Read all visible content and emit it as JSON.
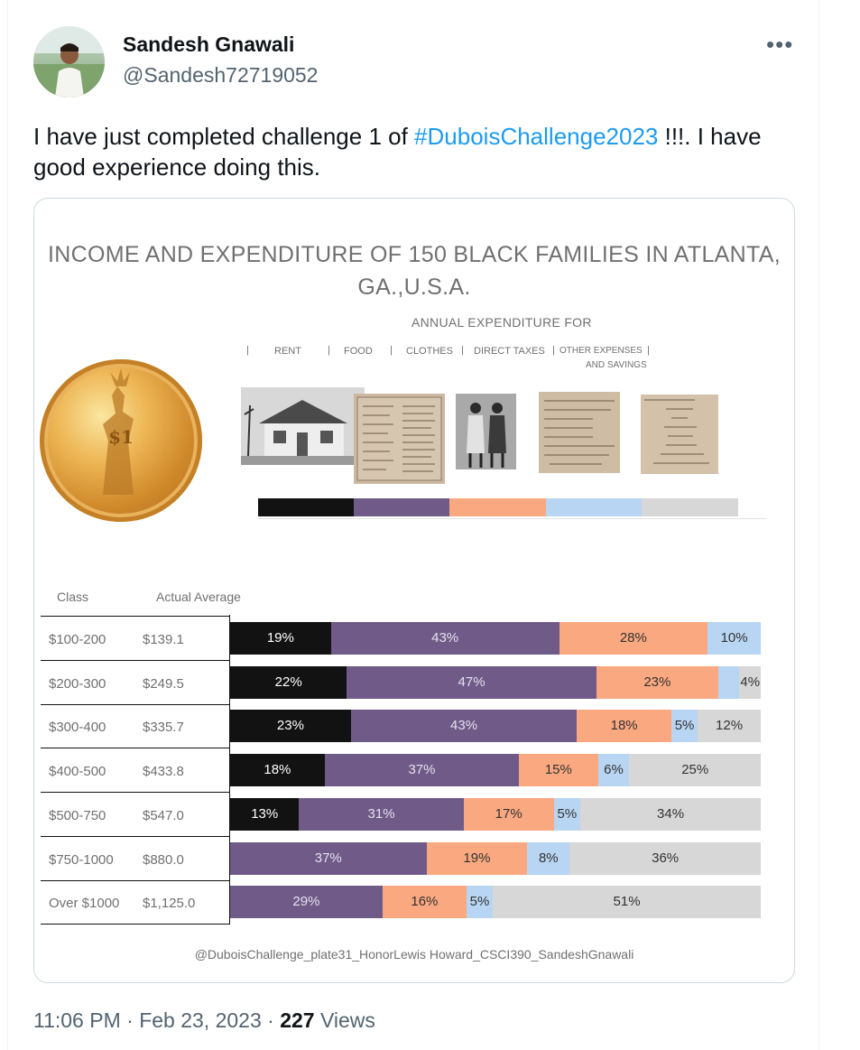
{
  "tweet": {
    "author_name": "Sandesh Gnawali",
    "author_handle": "@Sandesh72719052",
    "more_icon": "more-dots-icon",
    "text_before": "I have just completed challenge 1 of ",
    "hashtag": "#DuboisChallenge2023",
    "text_after": " !!!. I have good experience doing this.",
    "time": "11:06 PM",
    "date_sep": " · ",
    "date": "Feb 23, 2023",
    "views_count": "227",
    "views_label": "Views"
  },
  "viz": {
    "title": "INCOME AND EXPENDITURE OF 150 BLACK FAMILIES IN ATLANTA, GA.,U.S.A.",
    "subtitle": "ANNUAL EXPENDITURE FOR",
    "categories": [
      "RENT",
      "FOOD",
      "CLOTHES",
      "DIRECT TAXES",
      "OTHER EXPENSES",
      "AND SAVINGS"
    ],
    "coin_text": "$1",
    "col_class": "Class",
    "col_avg": "Actual Average",
    "credit": "@DuboisChallenge_plate31_HonorLewis Howard_CSCI390_SandeshGnawali",
    "colors": {
      "rent": "#121212",
      "food": "#6f5a88",
      "clothes": "#f9a880",
      "taxes": "#b8d5f3",
      "other": "#d7d7d7"
    }
  },
  "chart_data": {
    "type": "bar",
    "stacked": true,
    "orientation": "horizontal",
    "categories": [
      "$100-200",
      "$200-300",
      "$300-400",
      "$400-500",
      "$500-750",
      "$750-1000",
      "Over $1000"
    ],
    "actual_average": [
      "$139.1",
      "$249.5",
      "$335.7",
      "$433.8",
      "$547.0",
      "$880.0",
      "$1,125.0"
    ],
    "series": [
      {
        "name": "RENT",
        "values": [
          19,
          22,
          23,
          18,
          13,
          0,
          0
        ]
      },
      {
        "name": "FOOD",
        "values": [
          43,
          47,
          43,
          37,
          31,
          37,
          29
        ]
      },
      {
        "name": "CLOTHES",
        "values": [
          28,
          23,
          18,
          15,
          17,
          19,
          16
        ]
      },
      {
        "name": "DIRECT TAXES",
        "values": [
          10,
          4,
          5,
          6,
          5,
          8,
          5
        ]
      },
      {
        "name": "OTHER EXPENSES AND SAVINGS",
        "values": [
          0,
          4,
          12,
          25,
          34,
          36,
          51
        ]
      }
    ],
    "labels": [
      [
        "19%",
        "43%",
        "28%",
        "10%",
        ""
      ],
      [
        "22%",
        "47%",
        "23%",
        "",
        "4%"
      ],
      [
        "23%",
        "43%",
        "18%",
        "5%",
        "12%"
      ],
      [
        "18%",
        "37%",
        "15%",
        "6%",
        "25%"
      ],
      [
        "13%",
        "31%",
        "17%",
        "5%",
        "34%"
      ],
      [
        "",
        "37%",
        "19%",
        "8%",
        "36%"
      ],
      [
        "",
        "29%",
        "16%",
        "5%",
        "51%"
      ]
    ]
  }
}
